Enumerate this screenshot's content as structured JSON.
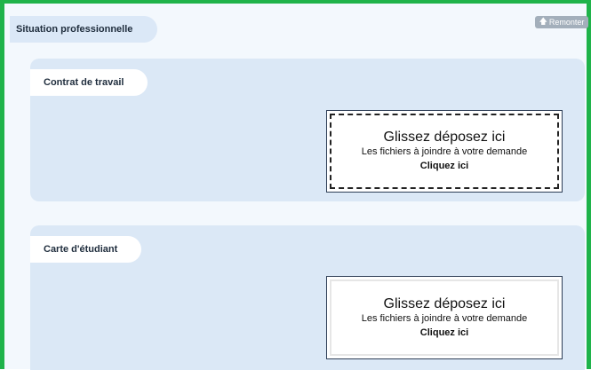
{
  "section": {
    "title": "Situation professionnelle",
    "back_to_top": "Remonter",
    "back_to_top_icon": "arrow-up-icon"
  },
  "documents": [
    {
      "label": "Contrat de travail",
      "dropzone": {
        "title": "Glissez déposez ici",
        "subtitle": "Les fichiers à joindre à votre demande",
        "cta": "Cliquez ici",
        "state": "active (dashed border)"
      }
    },
    {
      "label": "Carte d'étudiant",
      "dropzone": {
        "title": "Glissez déposez ici",
        "subtitle": "Les fichiers à joindre à votre demande",
        "cta": "Cliquez ici",
        "state": "idle"
      }
    }
  ],
  "colors": {
    "frame_border": "#1fb34a",
    "page_bg": "#f3f8fd",
    "panel_bg": "#dbe8f6",
    "button_bg": "#a3afbb"
  }
}
